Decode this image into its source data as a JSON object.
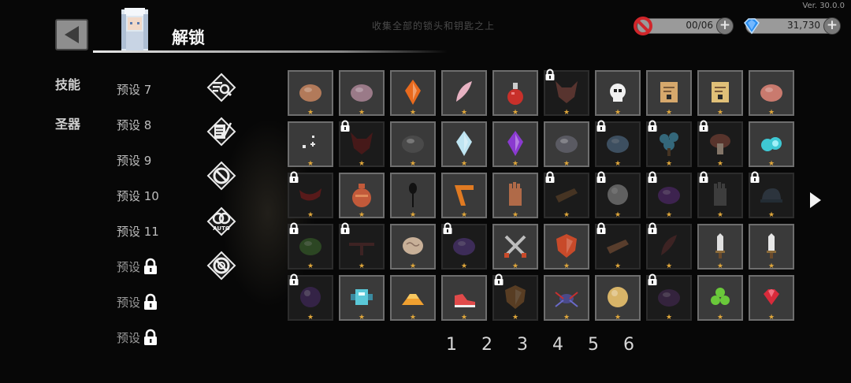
{
  "version": "Ver. 30.0.0",
  "header": {
    "title": "解锁",
    "faded_text": "收集全部的锁头和钥匙之上"
  },
  "resources": [
    {
      "name": "ban",
      "value": "00/06",
      "icon": "no-entry-icon",
      "color": "#d0262b"
    },
    {
      "name": "gems",
      "value": "31,730",
      "icon": "gem-icon",
      "color": "#2a8ef0"
    }
  ],
  "tabs": [
    {
      "label": "技能"
    },
    {
      "label": "圣器"
    }
  ],
  "presets": [
    {
      "label": "预设 7",
      "locked": false
    },
    {
      "label": "预设 8",
      "locked": false
    },
    {
      "label": "预设 9",
      "locked": false
    },
    {
      "label": "预设 10",
      "locked": false
    },
    {
      "label": "预设 11",
      "locked": false
    },
    {
      "label": "预设",
      "locked": true
    },
    {
      "label": "预设",
      "locked": true
    },
    {
      "label": "预设",
      "locked": true
    }
  ],
  "tools": [
    {
      "icon": "search-filter-icon"
    },
    {
      "icon": "scroll-quill-icon"
    },
    {
      "icon": "cancel-icon"
    },
    {
      "icon": "auto-icon",
      "label": "AUTO"
    },
    {
      "icon": "cancel-all-icon"
    }
  ],
  "relics": [
    [
      {
        "icon": "bread-loaf",
        "color": "#b27a5a",
        "locked": false,
        "stars": 1
      },
      {
        "icon": "garlic",
        "color": "#9a7a88",
        "locked": false,
        "stars": 1
      },
      {
        "icon": "fire-crystal",
        "color": "#e86a1e",
        "locked": false,
        "stars": 1
      },
      {
        "icon": "pink-feather",
        "color": "#e7b2c2",
        "locked": false,
        "stars": 1
      },
      {
        "icon": "red-potion",
        "color": "#c8302a",
        "locked": false,
        "stars": 1
      },
      {
        "icon": "fox-mask",
        "color": "#8a4a40",
        "locked": true,
        "stars": 1
      },
      {
        "icon": "skull",
        "color": "#f1f1f1",
        "locked": false,
        "stars": 1
      },
      {
        "icon": "letter",
        "color": "#d6a86c",
        "locked": false,
        "stars": 1
      },
      {
        "icon": "letter",
        "color": "#e0c078",
        "locked": false,
        "stars": 1
      },
      {
        "icon": "meat",
        "color": "#c97a6e",
        "locked": false,
        "stars": 1
      }
    ],
    [
      {
        "icon": "sparkle",
        "color": "#e6e6e6",
        "locked": false,
        "stars": 1
      },
      {
        "icon": "dark-heart",
        "color": "#6a1818",
        "locked": true,
        "stars": 1
      },
      {
        "icon": "coal",
        "color": "#4a4a4a",
        "locked": false,
        "stars": 1
      },
      {
        "icon": "ice-crystal",
        "color": "#bfe5f2",
        "locked": false,
        "stars": 1
      },
      {
        "icon": "purple-crystal",
        "color": "#8a3ad0",
        "locked": false,
        "stars": 1
      },
      {
        "icon": "rock",
        "color": "#5a5a62",
        "locked": false,
        "stars": 1
      },
      {
        "icon": "blue-fist",
        "color": "#5a7a9a",
        "locked": true,
        "stars": 1
      },
      {
        "icon": "blue-tree",
        "color": "#49a6c8",
        "locked": true,
        "stars": 1
      },
      {
        "icon": "mushroom",
        "color": "#8a4a3a",
        "locked": true,
        "stars": 1
      },
      {
        "icon": "cyan-orbs",
        "color": "#3ec8d4",
        "locked": false,
        "stars": 1
      }
    ],
    [
      {
        "icon": "red-scarf",
        "color": "#8a1a1a",
        "locked": true,
        "stars": 1
      },
      {
        "icon": "vase",
        "color": "#c25a3a",
        "locked": false,
        "stars": 1
      },
      {
        "icon": "dark-spoon",
        "color": "#222222",
        "locked": false,
        "stars": 1
      },
      {
        "icon": "orange-boomerang",
        "color": "#e07a22",
        "locked": false,
        "stars": 1
      },
      {
        "icon": "glove",
        "color": "#b06a48",
        "locked": false,
        "stars": 1
      },
      {
        "icon": "plank",
        "color": "#6a4a2a",
        "locked": true,
        "stars": 1
      },
      {
        "icon": "orb",
        "color": "#9a9a9a",
        "locked": true,
        "stars": 1
      },
      {
        "icon": "purple-pot",
        "color": "#5a2a7a",
        "locked": true,
        "stars": 1
      },
      {
        "icon": "gauntlet",
        "color": "#5a5a5a",
        "locked": true,
        "stars": 1
      },
      {
        "icon": "cap",
        "color": "#3a4a5a",
        "locked": true,
        "stars": 1
      }
    ],
    [
      {
        "icon": "green-shell",
        "color": "#3a6a2a",
        "locked": true,
        "stars": 1
      },
      {
        "icon": "dark-rifle",
        "color": "#5a2a2a",
        "locked": true,
        "stars": 1
      },
      {
        "icon": "brain",
        "color": "#c8b098",
        "locked": false,
        "stars": 1
      },
      {
        "icon": "purple-lightning",
        "color": "#5a3a8a",
        "locked": true,
        "stars": 1
      },
      {
        "icon": "crossed-swords",
        "color": "#bdbdbd",
        "locked": false,
        "stars": 1
      },
      {
        "icon": "red-shield",
        "color": "#c84a2a",
        "locked": false,
        "stars": 1
      },
      {
        "icon": "blue-board",
        "color": "#8a5a3a",
        "locked": true,
        "stars": 1
      },
      {
        "icon": "feather",
        "color": "#5a2a2a",
        "locked": true,
        "stars": 1
      },
      {
        "icon": "dagger",
        "color": "#e0e0e0",
        "locked": false,
        "stars": 1
      },
      {
        "icon": "knife",
        "color": "#e8e8e8",
        "locked": false,
        "stars": 1
      }
    ],
    [
      {
        "icon": "dark-orb",
        "color": "#4a2a6a",
        "locked": true,
        "stars": 1
      },
      {
        "icon": "cyan-robot",
        "color": "#5ac8d8",
        "locked": false,
        "stars": 1
      },
      {
        "icon": "gold-bars",
        "color": "#f0a030",
        "locked": false,
        "stars": 1
      },
      {
        "icon": "sneaker",
        "color": "#e04a4a",
        "locked": false,
        "stars": 1
      },
      {
        "icon": "wood-shield",
        "color": "#8a5a2a",
        "locked": true,
        "stars": 1
      },
      {
        "icon": "spider",
        "color": "#4a4a8a",
        "locked": false,
        "stars": 1
      },
      {
        "icon": "gold-coin",
        "color": "#d8b468",
        "locked": false,
        "stars": 1
      },
      {
        "icon": "purple-cloak",
        "color": "#4a2a5a",
        "locked": true,
        "stars": 1
      },
      {
        "icon": "green-slime",
        "color": "#6ac83a",
        "locked": false,
        "stars": 1
      },
      {
        "icon": "red-gem",
        "color": "#d82a3a",
        "locked": false,
        "stars": 1
      }
    ]
  ],
  "pages": [
    "1",
    "2",
    "3",
    "4",
    "5",
    "6"
  ],
  "next_arrow": {
    "icon": "chevron-right-icon"
  }
}
